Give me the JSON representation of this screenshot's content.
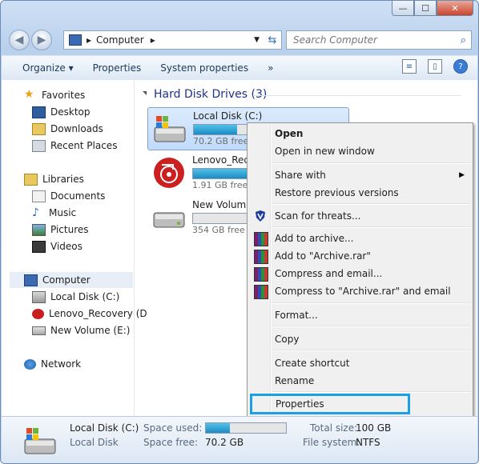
{
  "window": {
    "caption": {
      "minimize": "—",
      "maximize": "☐",
      "close": "✕"
    }
  },
  "nav": {
    "back": "◀",
    "forward": "▶",
    "address": {
      "crumbs": [
        "Computer"
      ],
      "separator": "▸"
    },
    "search_placeholder": "Search Computer"
  },
  "toolbar": {
    "organize": "Organize ▾",
    "properties": "Properties",
    "system_properties": "System properties",
    "more": "»"
  },
  "sidebar": {
    "favorites": {
      "label": "Favorites",
      "items": [
        "Desktop",
        "Downloads",
        "Recent Places"
      ]
    },
    "libraries": {
      "label": "Libraries",
      "items": [
        "Documents",
        "Music",
        "Pictures",
        "Videos"
      ]
    },
    "computer": {
      "label": "Computer",
      "items": [
        "Local Disk (C:)",
        "Lenovo_Recovery (D",
        "New Volume (E:)"
      ]
    },
    "network": {
      "label": "Network"
    }
  },
  "main": {
    "group_title": "Hard Disk Drives (3)",
    "drives": [
      {
        "name": "Local Disk (C:)",
        "free": "70.2 GB free o",
        "used_fraction": 0.3
      },
      {
        "name": "Lenovo_Reco",
        "free": "1.91 GB free o",
        "used_fraction": 0.88
      },
      {
        "name": "New Volume",
        "free": "354 GB free o",
        "used_fraction": 0.0
      }
    ]
  },
  "context_menu": {
    "items": {
      "open": "Open",
      "open_new_window": "Open in new window",
      "share_with": "Share with",
      "restore_previous": "Restore previous versions",
      "scan_threats": "Scan for threats...",
      "add_archive": "Add to archive...",
      "add_archive_rar": "Add to \"Archive.rar\"",
      "compress_email": "Compress and email...",
      "compress_rar_email": "Compress to \"Archive.rar\" and email",
      "format": "Format...",
      "copy": "Copy",
      "create_shortcut": "Create shortcut",
      "rename": "Rename",
      "properties": "Properties"
    },
    "highlight_color": "#1ba1e2"
  },
  "details": {
    "name": "Local Disk (C:)",
    "type": "Local Disk",
    "space_used_label": "Space used:",
    "space_free_label": "Space free:",
    "space_free": "70.2 GB",
    "total_size_label": "Total size:",
    "total_size": "100 GB",
    "file_system_label": "File system:",
    "file_system": "NTFS",
    "used_fraction": 0.3
  }
}
